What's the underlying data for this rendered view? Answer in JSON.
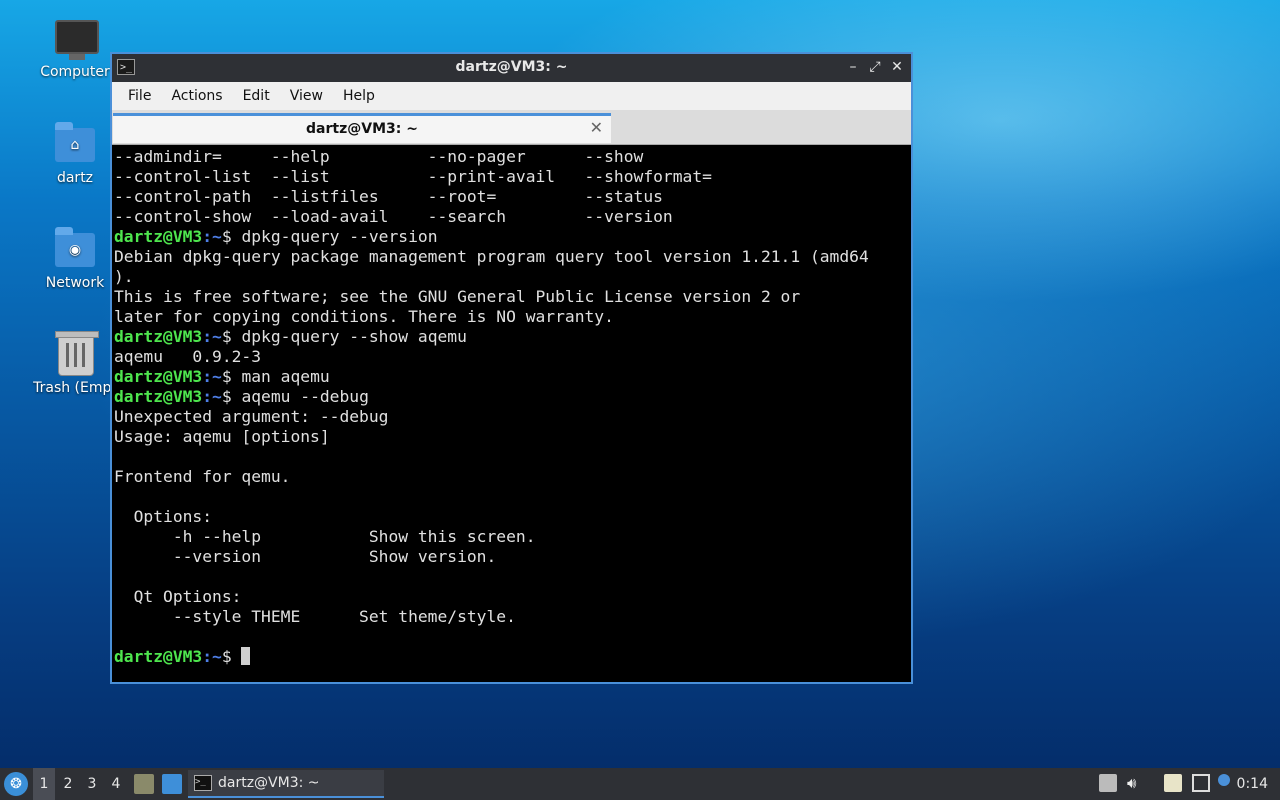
{
  "desktop": {
    "icons": [
      {
        "label": "Computer"
      },
      {
        "label": "dartz"
      },
      {
        "label": "Network"
      },
      {
        "label": "Trash (Empt"
      }
    ]
  },
  "window": {
    "title": "dartz@VM3: ~",
    "controls": {
      "minimize": "–",
      "maximize": "⤢",
      "close": "✕"
    },
    "menu": [
      "File",
      "Actions",
      "Edit",
      "View",
      "Help"
    ],
    "tab": {
      "label": "dartz@VM3: ~",
      "close": "✕"
    }
  },
  "terminal": {
    "prompt_user": "dartz@VM3",
    "prompt_path": ":~",
    "prompt_sign": "$ ",
    "lines": [
      {
        "type": "out",
        "text": "--admindir=     --help          --no-pager      --show"
      },
      {
        "type": "out",
        "text": "--control-list  --list          --print-avail   --showformat="
      },
      {
        "type": "out",
        "text": "--control-path  --listfiles     --root=         --status"
      },
      {
        "type": "out",
        "text": "--control-show  --load-avail    --search        --version"
      },
      {
        "type": "cmd",
        "text": "dpkg-query --version"
      },
      {
        "type": "out",
        "text": "Debian dpkg-query package management program query tool version 1.21.1 (amd64"
      },
      {
        "type": "out",
        "text": ")."
      },
      {
        "type": "out",
        "text": "This is free software; see the GNU General Public License version 2 or"
      },
      {
        "type": "out",
        "text": "later for copying conditions. There is NO warranty."
      },
      {
        "type": "cmd",
        "text": "dpkg-query --show aqemu"
      },
      {
        "type": "out",
        "text": "aqemu   0.9.2-3"
      },
      {
        "type": "cmd",
        "text": "man aqemu"
      },
      {
        "type": "cmd",
        "text": "aqemu --debug"
      },
      {
        "type": "out",
        "text": "Unexpected argument: --debug"
      },
      {
        "type": "out",
        "text": "Usage: aqemu [options]"
      },
      {
        "type": "out",
        "text": ""
      },
      {
        "type": "out",
        "text": "Frontend for qemu."
      },
      {
        "type": "out",
        "text": ""
      },
      {
        "type": "out",
        "text": "  Options:"
      },
      {
        "type": "out",
        "text": "      -h --help           Show this screen."
      },
      {
        "type": "out",
        "text": "      --version           Show version."
      },
      {
        "type": "out",
        "text": ""
      },
      {
        "type": "out",
        "text": "  Qt Options:"
      },
      {
        "type": "out",
        "text": "      --style THEME      Set theme/style."
      },
      {
        "type": "out",
        "text": ""
      },
      {
        "type": "prompt",
        "text": ""
      }
    ]
  },
  "taskbar": {
    "workspaces": [
      "1",
      "2",
      "3",
      "4"
    ],
    "active_workspace": "1",
    "task_label": "dartz@VM3: ~",
    "clock": "0:14",
    "tray_icons": [
      "eject-icon",
      "volume-icon",
      "clipboard-icon",
      "network-icon",
      "notification-icon"
    ]
  }
}
